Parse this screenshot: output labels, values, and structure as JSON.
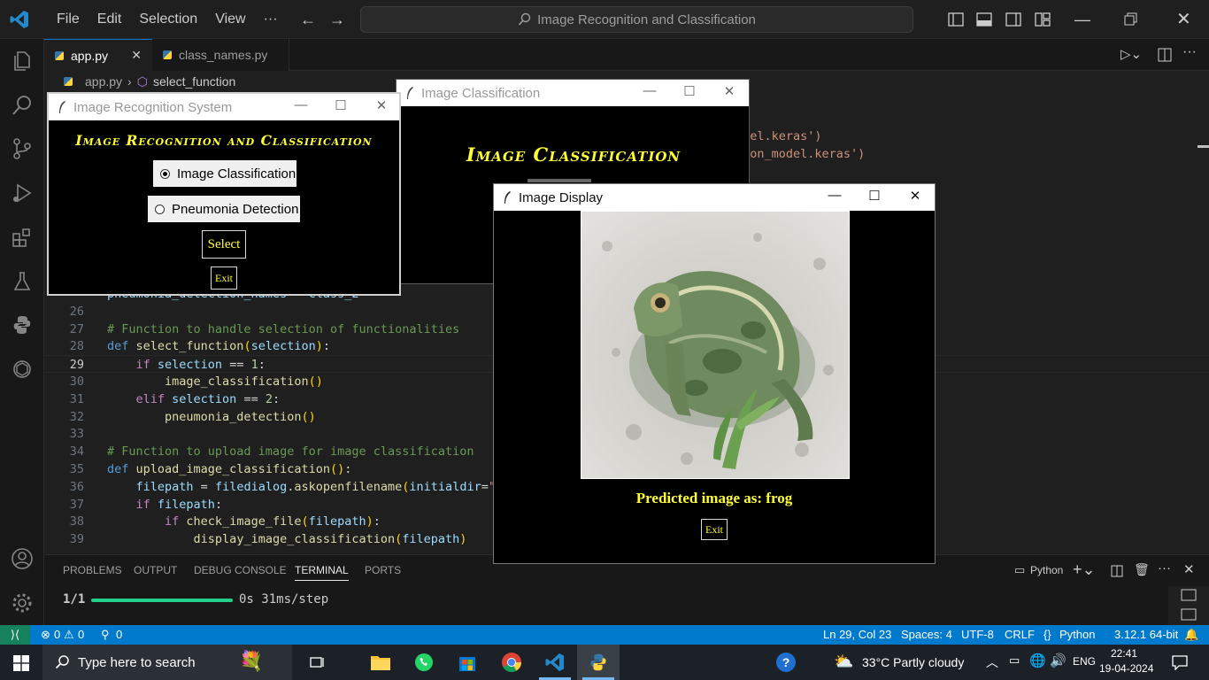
{
  "window_title": "Image Recognition and Classification",
  "menu": [
    "File",
    "Edit",
    "Selection",
    "View",
    "···"
  ],
  "tabs": [
    {
      "label": "app.py",
      "active": true
    },
    {
      "label": "class_names.py",
      "active": false
    }
  ],
  "breadcrumb": {
    "file": "app.py",
    "symbol": "select_function"
  },
  "code_fragments": {
    "frag1": "odel.keras')",
    "frag2": "tion_model.keras')",
    "frag25": "pneumonia_detection_names = class_2"
  },
  "code_lines": [
    {
      "n": "26",
      "text": ""
    },
    {
      "n": "27",
      "text": "# Function to handle selection of functionalities"
    },
    {
      "n": "28",
      "text": "def select_function(selection):"
    },
    {
      "n": "29",
      "text": "    if selection == 1:"
    },
    {
      "n": "30",
      "text": "        image_classification()"
    },
    {
      "n": "31",
      "text": "    elif selection == 2:"
    },
    {
      "n": "32",
      "text": "        pneumonia_detection()"
    },
    {
      "n": "33",
      "text": ""
    },
    {
      "n": "34",
      "text": "# Function to upload image for image classification"
    },
    {
      "n": "35",
      "text": "def upload_image_classification():"
    },
    {
      "n": "36",
      "text": "    filepath = filedialog.askopenfilename(initialdir=\""
    },
    {
      "n": "37",
      "text": "    if filepath:"
    },
    {
      "n": "38",
      "text": "        if check_image_file(filepath):"
    },
    {
      "n": "39",
      "text": "            display_image_classification(filepath)"
    }
  ],
  "panel": {
    "tabs": [
      "PROBLEMS",
      "OUTPUT",
      "DEBUG CONSOLE",
      "TERMINAL",
      "PORTS"
    ],
    "active_tab": "TERMINAL",
    "terminal_prefix": "1/1",
    "terminal_suffix": "0s 31ms/step",
    "progress": 1.0,
    "shell": "Python"
  },
  "statusbar": {
    "errors": "0",
    "warnings": "0",
    "ports": "0",
    "position": "Ln 29, Col 23",
    "spaces": "Spaces: 4",
    "encoding": "UTF-8",
    "eol": "CRLF",
    "language": "Python",
    "interpreter": "3.12.1 64-bit"
  },
  "taskbar": {
    "search_placeholder": "Type here to search",
    "weather": "33°C  Partly cloudy",
    "lang": "ENG",
    "time": "22:41",
    "date": "19-04-2024"
  },
  "win_recognition": {
    "title": "Image Recognition System",
    "heading": "Image Recognition and Classification",
    "option1": "Image Classification",
    "option2": "Pneumonia Detection",
    "selected": 1,
    "select_label": "Select",
    "exit_label": "Exit"
  },
  "win_classification": {
    "title": "Image Classification",
    "heading": "Image Classification"
  },
  "win_display": {
    "title": "Image Display",
    "prediction": "Predicted image as: frog",
    "exit_label": "Exit"
  },
  "colors": {
    "accent": "#007acc",
    "tk_text": "#ffff33",
    "terminal_progress": "#23d18b"
  }
}
